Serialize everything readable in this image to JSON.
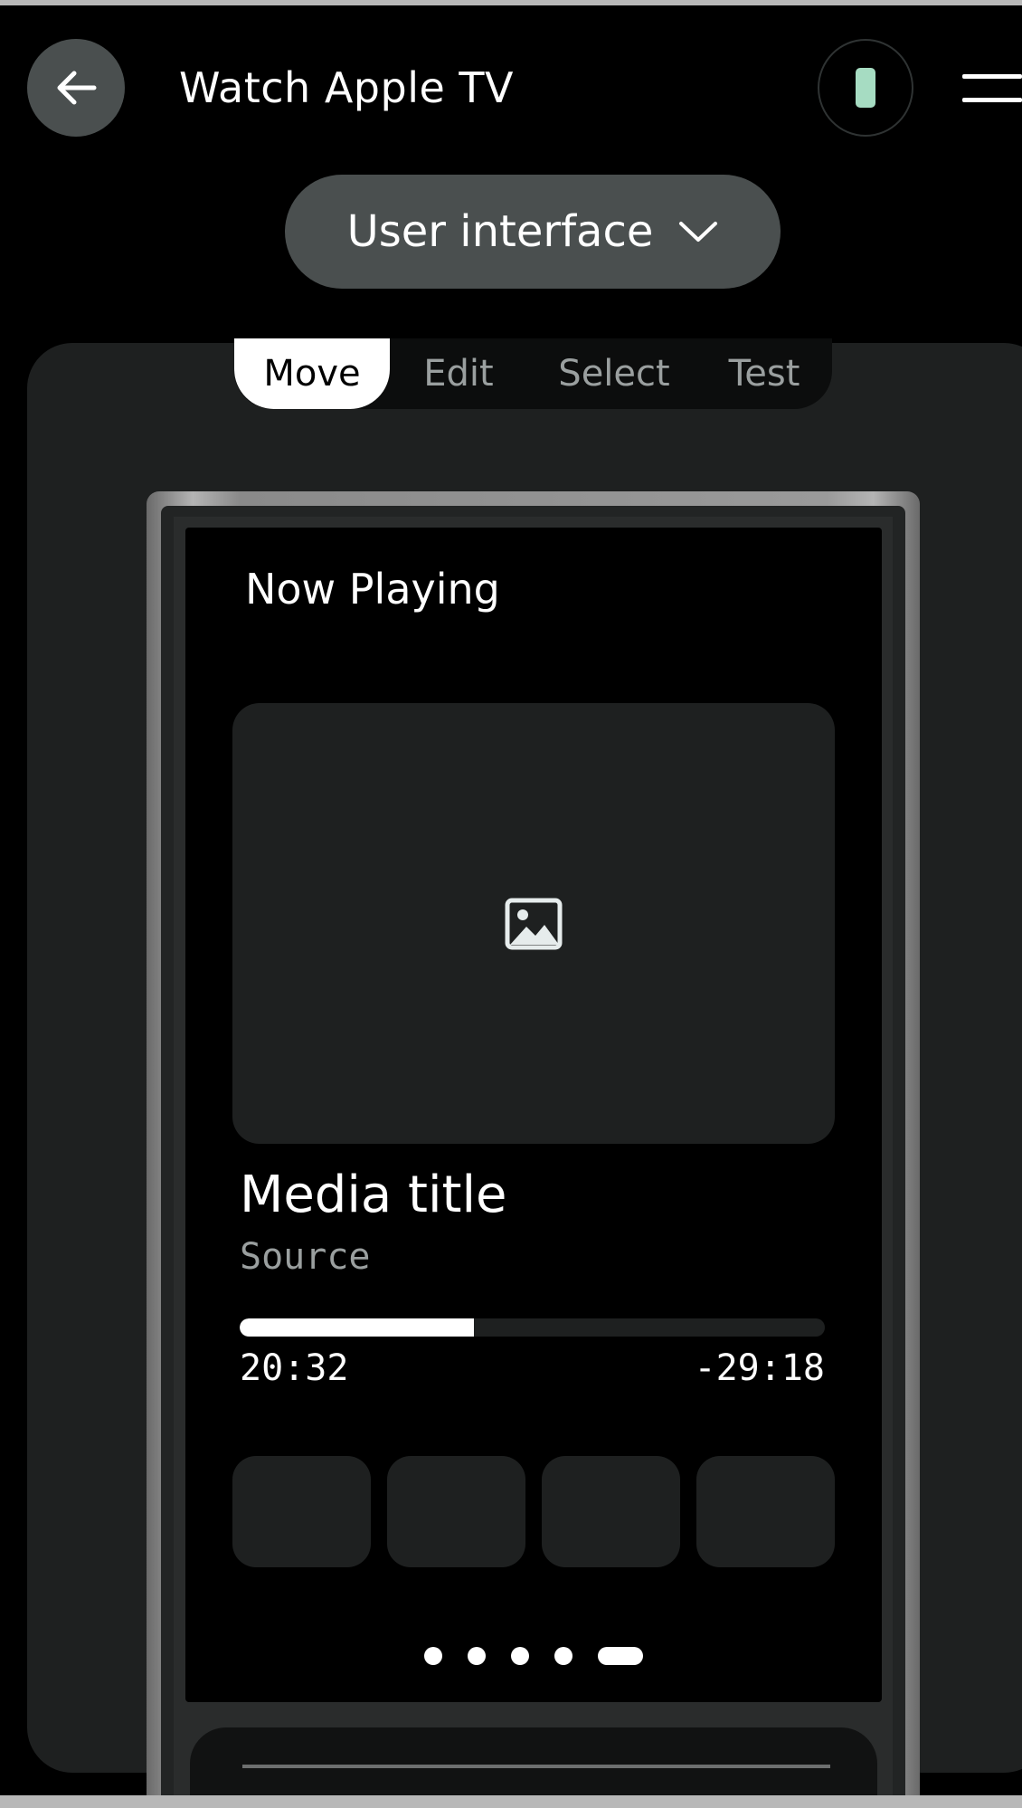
{
  "header": {
    "title": "Watch Apple TV",
    "back_icon": "arrow-left-icon",
    "device_icon": "remote-device-icon",
    "menu_icon": "hamburger-menu-icon"
  },
  "dropdown": {
    "label": "User interface",
    "icon": "chevron-down-icon"
  },
  "tabs": [
    {
      "label": "Move",
      "active": true
    },
    {
      "label": "Edit",
      "active": false
    },
    {
      "label": "Select",
      "active": false
    },
    {
      "label": "Test",
      "active": false
    }
  ],
  "screen": {
    "heading": "Now Playing",
    "artwork_icon": "image-placeholder-icon",
    "media_title": "Media title",
    "media_source": "Source",
    "progress": 0.4,
    "time_elapsed": "20:32",
    "time_remaining": "-29:18",
    "control_buttons": 4,
    "page_dots": 5,
    "active_page": 5
  },
  "colors": {
    "background": "#000000",
    "panel": "#1e2020",
    "button": "#4a4f4f",
    "accent": "#a6dcc2",
    "muted_text": "#9a9f9f"
  }
}
